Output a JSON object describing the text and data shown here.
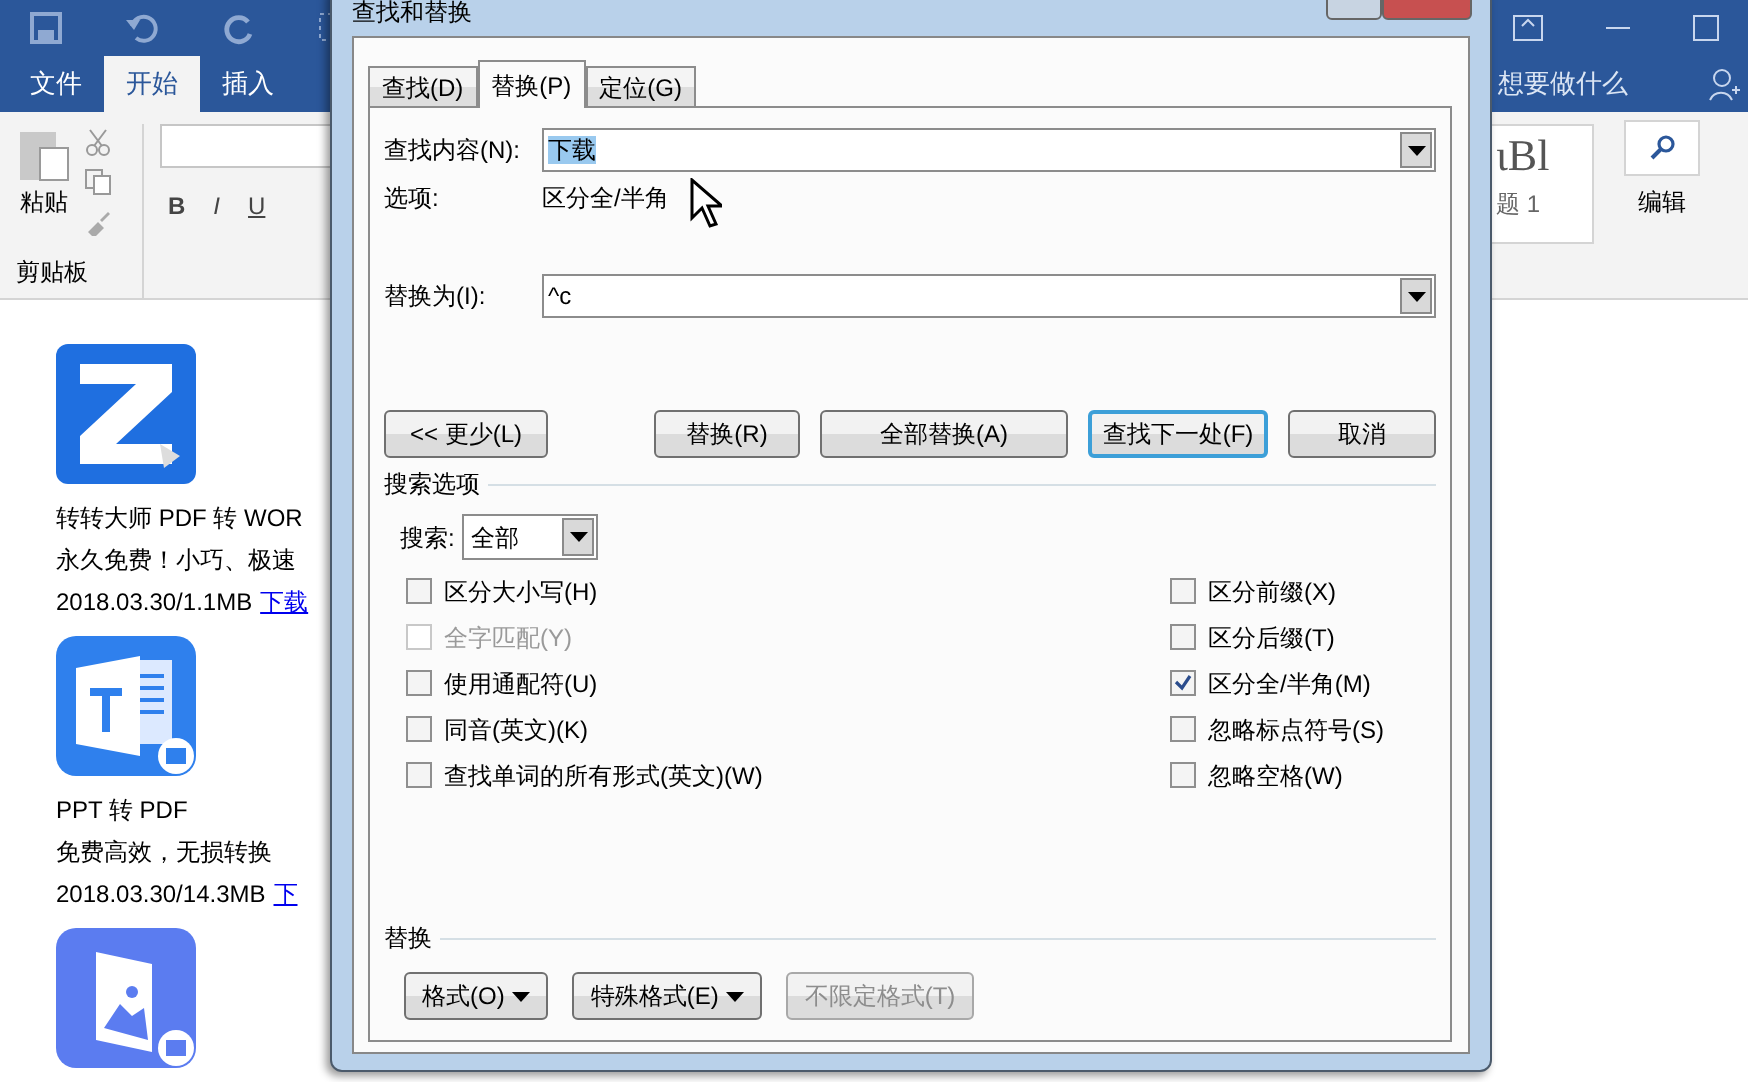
{
  "word": {
    "tabs": [
      {
        "label": "文件",
        "selected": false
      },
      {
        "label": "开始",
        "selected": true
      },
      {
        "label": "插入",
        "selected": false
      }
    ],
    "tell_me": "想要做什么",
    "clipboard": {
      "paste": "粘贴",
      "group": "剪贴板"
    },
    "format_buttons": [
      "B",
      "I",
      "U"
    ],
    "styles": {
      "preview": "ιBl",
      "caption": "题 1"
    },
    "editing": "编辑",
    "documents": [
      {
        "kind": "z",
        "title": "转转大师 PDF 转 WOR",
        "desc": "永久免费！小巧、极速",
        "meta": "2018.03.30/1.1MB",
        "link": "下载"
      },
      {
        "kind": "ppt",
        "title": "PPT 转 PDF",
        "desc": "免费高效，无损转换",
        "meta": "2018.03.30/14.3MB",
        "link": "下"
      },
      {
        "kind": "image"
      }
    ]
  },
  "dialog": {
    "title": "查找和替换",
    "tabs": [
      {
        "label": "查找(D)",
        "selected": false
      },
      {
        "label": "替换(P)",
        "selected": true
      },
      {
        "label": "定位(G)",
        "selected": false
      }
    ],
    "find": {
      "label": "查找内容(N):",
      "value": "下载",
      "highlighted": true
    },
    "options_label": "选项:",
    "options_value": "区分全/半角",
    "replace": {
      "label": "替换为(I):",
      "value": "^c"
    },
    "buttons": [
      {
        "label": "<< 更少(L)",
        "focused": false
      },
      {
        "label": "替换(R)",
        "focused": false
      },
      {
        "label": "全部替换(A)",
        "focused": false
      },
      {
        "label": "查找下一处(F)",
        "focused": true
      },
      {
        "label": "取消",
        "focused": false
      }
    ],
    "search_options": {
      "heading": "搜索选项",
      "search_label": "搜索:",
      "search_value": "全部",
      "left": [
        {
          "label": "区分大小写(H)",
          "checked": false,
          "disabled": false
        },
        {
          "label": "全字匹配(Y)",
          "checked": false,
          "disabled": true
        },
        {
          "label": "使用通配符(U)",
          "checked": false,
          "disabled": false
        },
        {
          "label": "同音(英文)(K)",
          "checked": false,
          "disabled": false
        },
        {
          "label": "查找单词的所有形式(英文)(W)",
          "checked": false,
          "disabled": false
        }
      ],
      "right": [
        {
          "label": "区分前缀(X)",
          "checked": false,
          "disabled": false
        },
        {
          "label": "区分后缀(T)",
          "checked": false,
          "disabled": false
        },
        {
          "label": "区分全/半角(M)",
          "checked": true,
          "disabled": false
        },
        {
          "label": "忽略标点符号(S)",
          "checked": false,
          "disabled": false
        },
        {
          "label": "忽略空格(W)",
          "checked": false,
          "disabled": false
        }
      ]
    },
    "replace_section": {
      "heading": "替换",
      "buttons": [
        {
          "label": "格式(O)",
          "menu": true,
          "disabled": false
        },
        {
          "label": "特殊格式(E)",
          "menu": true,
          "disabled": false
        },
        {
          "label": "不限定格式(T)",
          "menu": false,
          "disabled": true
        }
      ]
    }
  }
}
